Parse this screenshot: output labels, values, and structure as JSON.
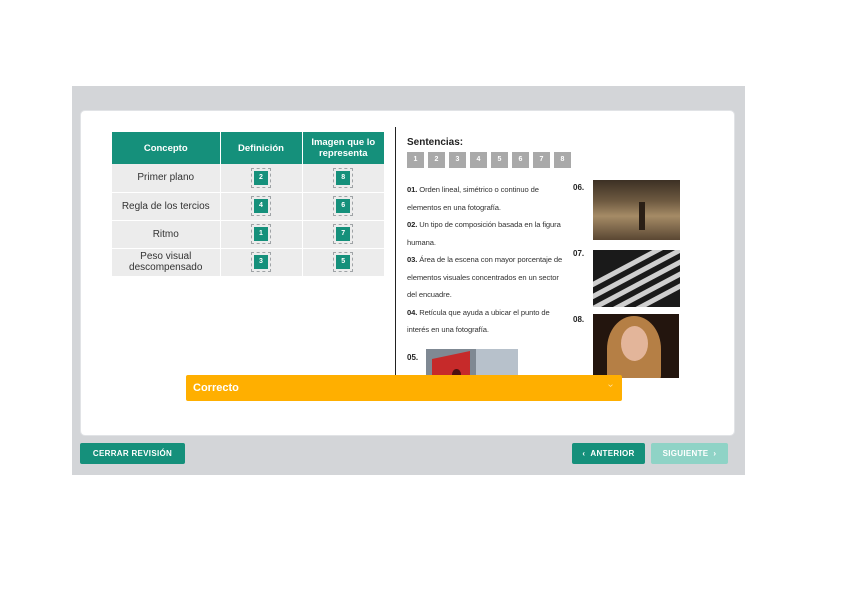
{
  "table": {
    "headers": [
      "Concepto",
      "Definición",
      "Imagen que lo representa"
    ],
    "rows": [
      {
        "concept": "Primer plano",
        "definition": "2",
        "image": "8"
      },
      {
        "concept": "Regla de los tercios",
        "definition": "4",
        "image": "6"
      },
      {
        "concept": "Ritmo",
        "definition": "1",
        "image": "7"
      },
      {
        "concept": "Peso visual descompensado",
        "definition": "3",
        "image": "5"
      }
    ]
  },
  "sentences": {
    "title": "Sentencias:",
    "tiles": [
      "1",
      "2",
      "3",
      "4",
      "5",
      "6",
      "7",
      "8"
    ],
    "items": [
      {
        "num": "01.",
        "text": "Orden lineal, simétrico o continuo de elementos en una fotografía."
      },
      {
        "num": "02.",
        "text": "Un tipo de composición basada en la figura humana."
      },
      {
        "num": "03.",
        "text": "Área de la escena con mayor porcentaje de elementos visuales concentrados en un sector del encuadre."
      },
      {
        "num": "04.",
        "text": "Retícula que ayuda a ubicar el punto de interés en una fotografía."
      }
    ]
  },
  "images": {
    "l06": "06.",
    "l07": "07.",
    "l08": "08.",
    "l05": "05."
  },
  "feedback": {
    "text": "Correcto",
    "color": "#ffaf00"
  },
  "buttons": {
    "close": "CERRAR REVISIÓN",
    "prev": "ANTERIOR",
    "next": "SIGUIENTE"
  },
  "colors": {
    "accent": "#15907b",
    "disabled": "#8fd3c6"
  }
}
